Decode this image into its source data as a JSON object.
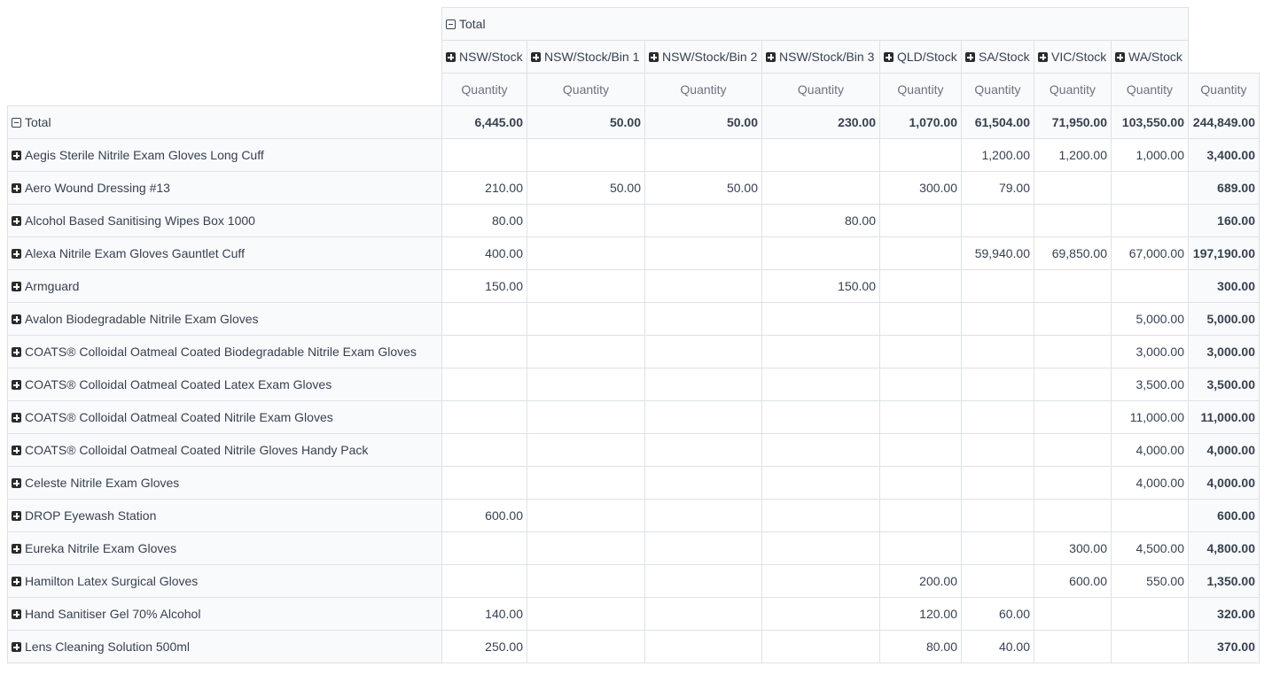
{
  "header": {
    "total_label": "Total",
    "columns": [
      "NSW/Stock",
      "NSW/Stock/Bin 1",
      "NSW/Stock/Bin 2",
      "NSW/Stock/Bin 3",
      "QLD/Stock",
      "SA/Stock",
      "VIC/Stock",
      "WA/Stock"
    ],
    "measure_label": "Quantity"
  },
  "rows_total": {
    "label": "Total",
    "values": [
      "6,445.00",
      "50.00",
      "50.00",
      "230.00",
      "1,070.00",
      "61,504.00",
      "71,950.00",
      "103,550.00",
      "244,849.00"
    ]
  },
  "rows": [
    {
      "label": "Aegis Sterile Nitrile Exam Gloves Long Cuff",
      "values": [
        "",
        "",
        "",
        "",
        "",
        "1,200.00",
        "1,200.00",
        "1,000.00",
        "3,400.00"
      ]
    },
    {
      "label": "Aero Wound Dressing #13",
      "values": [
        "210.00",
        "50.00",
        "50.00",
        "",
        "300.00",
        "79.00",
        "",
        "",
        "689.00"
      ]
    },
    {
      "label": "Alcohol Based Sanitising Wipes Box 1000",
      "values": [
        "80.00",
        "",
        "",
        "80.00",
        "",
        "",
        "",
        "",
        "160.00"
      ]
    },
    {
      "label": "Alexa Nitrile Exam Gloves Gauntlet Cuff",
      "values": [
        "400.00",
        "",
        "",
        "",
        "",
        "59,940.00",
        "69,850.00",
        "67,000.00",
        "197,190.00"
      ]
    },
    {
      "label": "Armguard",
      "values": [
        "150.00",
        "",
        "",
        "150.00",
        "",
        "",
        "",
        "",
        "300.00"
      ]
    },
    {
      "label": "Avalon Biodegradable Nitrile Exam Gloves",
      "values": [
        "",
        "",
        "",
        "",
        "",
        "",
        "",
        "5,000.00",
        "5,000.00"
      ]
    },
    {
      "label": "COATS® Colloidal Oatmeal Coated Biodegradable Nitrile Exam Gloves",
      "values": [
        "",
        "",
        "",
        "",
        "",
        "",
        "",
        "3,000.00",
        "3,000.00"
      ]
    },
    {
      "label": "COATS® Colloidal Oatmeal Coated Latex Exam Gloves",
      "values": [
        "",
        "",
        "",
        "",
        "",
        "",
        "",
        "3,500.00",
        "3,500.00"
      ]
    },
    {
      "label": "COATS® Colloidal Oatmeal Coated Nitrile Exam Gloves",
      "values": [
        "",
        "",
        "",
        "",
        "",
        "",
        "",
        "11,000.00",
        "11,000.00"
      ]
    },
    {
      "label": "COATS® Colloidal Oatmeal Coated Nitrile Gloves Handy Pack",
      "values": [
        "",
        "",
        "",
        "",
        "",
        "",
        "",
        "4,000.00",
        "4,000.00"
      ]
    },
    {
      "label": "Celeste Nitrile Exam Gloves",
      "values": [
        "",
        "",
        "",
        "",
        "",
        "",
        "",
        "4,000.00",
        "4,000.00"
      ]
    },
    {
      "label": "DROP Eyewash Station",
      "values": [
        "600.00",
        "",
        "",
        "",
        "",
        "",
        "",
        "",
        "600.00"
      ]
    },
    {
      "label": "Eureka Nitrile Exam Gloves",
      "values": [
        "",
        "",
        "",
        "",
        "",
        "",
        "300.00",
        "4,500.00",
        "4,800.00"
      ]
    },
    {
      "label": "Hamilton Latex Surgical Gloves",
      "values": [
        "",
        "",
        "",
        "",
        "200.00",
        "",
        "600.00",
        "550.00",
        "1,350.00"
      ]
    },
    {
      "label": "Hand Sanitiser Gel 70% Alcohol",
      "values": [
        "140.00",
        "",
        "",
        "",
        "120.00",
        "60.00",
        "",
        "",
        "320.00"
      ]
    },
    {
      "label": "Lens Cleaning Solution 500ml",
      "values": [
        "250.00",
        "",
        "",
        "",
        "80.00",
        "40.00",
        "",
        "",
        "370.00"
      ]
    }
  ]
}
